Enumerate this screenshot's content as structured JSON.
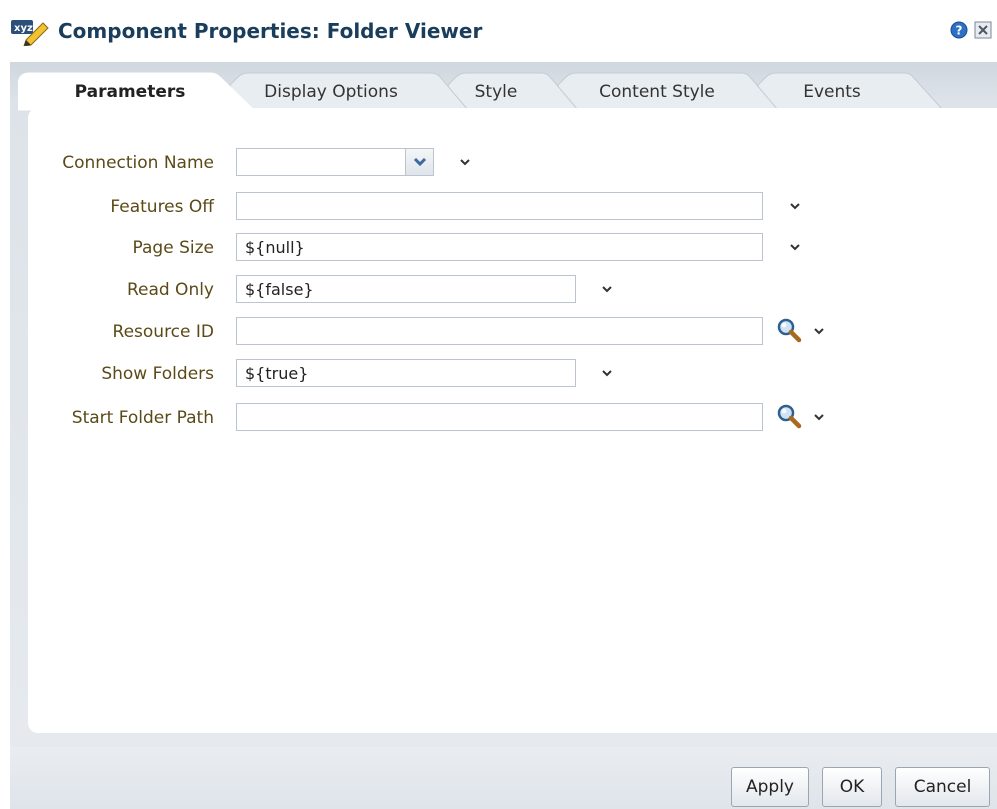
{
  "dialog": {
    "title": "Component Properties: Folder Viewer",
    "icons": {
      "title": "edit-pencil-xyz-icon",
      "help": "help-icon",
      "close": "close-icon"
    }
  },
  "tabs": [
    {
      "label": "Parameters",
      "active": true
    },
    {
      "label": "Display Options",
      "active": false
    },
    {
      "label": "Style",
      "active": false
    },
    {
      "label": "Content Style",
      "active": false
    },
    {
      "label": "Events",
      "active": false
    }
  ],
  "form": {
    "rows": [
      {
        "label": "Connection Name",
        "value": "",
        "control": "select"
      },
      {
        "label": "Features Off",
        "value": "",
        "control": "text"
      },
      {
        "label": "Page Size",
        "value": "${null}",
        "control": "text"
      },
      {
        "label": "Read Only",
        "value": "${false}",
        "control": "text"
      },
      {
        "label": "Resource ID",
        "value": "",
        "control": "text-search"
      },
      {
        "label": "Show Folders",
        "value": "${true}",
        "control": "text"
      },
      {
        "label": "Start Folder Path",
        "value": "",
        "control": "text-search"
      }
    ]
  },
  "footer": {
    "apply_label": "Apply",
    "ok_label": "OK",
    "cancel_label": "Cancel"
  },
  "colors": {
    "title": "#1a3d5c",
    "label": "#5b4a18",
    "panel_bg": "#e3e8ed",
    "field_border": "#bcc5cf"
  }
}
